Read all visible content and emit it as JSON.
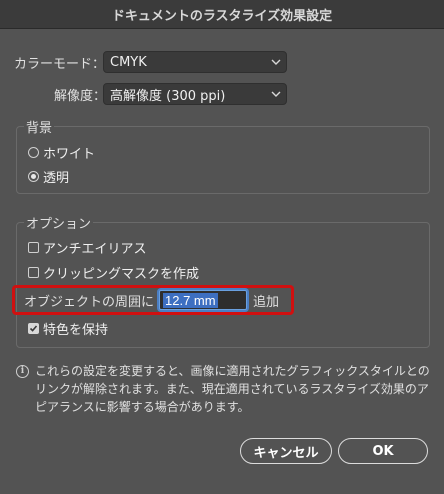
{
  "window": {
    "title": "ドキュメントのラスタライズ効果設定"
  },
  "color_mode": {
    "label": "カラーモード：",
    "value": "CMYK"
  },
  "resolution": {
    "label": "解像度：",
    "value": "高解像度 (300 ppi)"
  },
  "background": {
    "title": "背景",
    "options": [
      {
        "label": "ホワイト",
        "selected": false
      },
      {
        "label": "透明",
        "selected": true
      }
    ]
  },
  "options": {
    "title": "オプション",
    "antialias": {
      "label": "アンチエイリアス",
      "checked": false
    },
    "clipping_mask": {
      "label": "クリッピングマスクを作成",
      "checked": false
    },
    "surround": {
      "label": "オブジェクトの周囲に",
      "value": "12.7 mm",
      "suffix": "追加"
    },
    "preserve_spot": {
      "label": "特色を保持",
      "checked": true
    }
  },
  "note": {
    "icon": "info-icon",
    "text": "これらの設定を変更すると、画像に適用されたグラフィックスタイルとのリンクが解除されます。また、現在適用されているラスタライズ効果のアピアランスに影響する場合があります。"
  },
  "buttons": {
    "cancel": "キャンセル",
    "ok": "OK"
  },
  "colors": {
    "highlight": "#d01010",
    "selection": "#3d6fc1"
  }
}
